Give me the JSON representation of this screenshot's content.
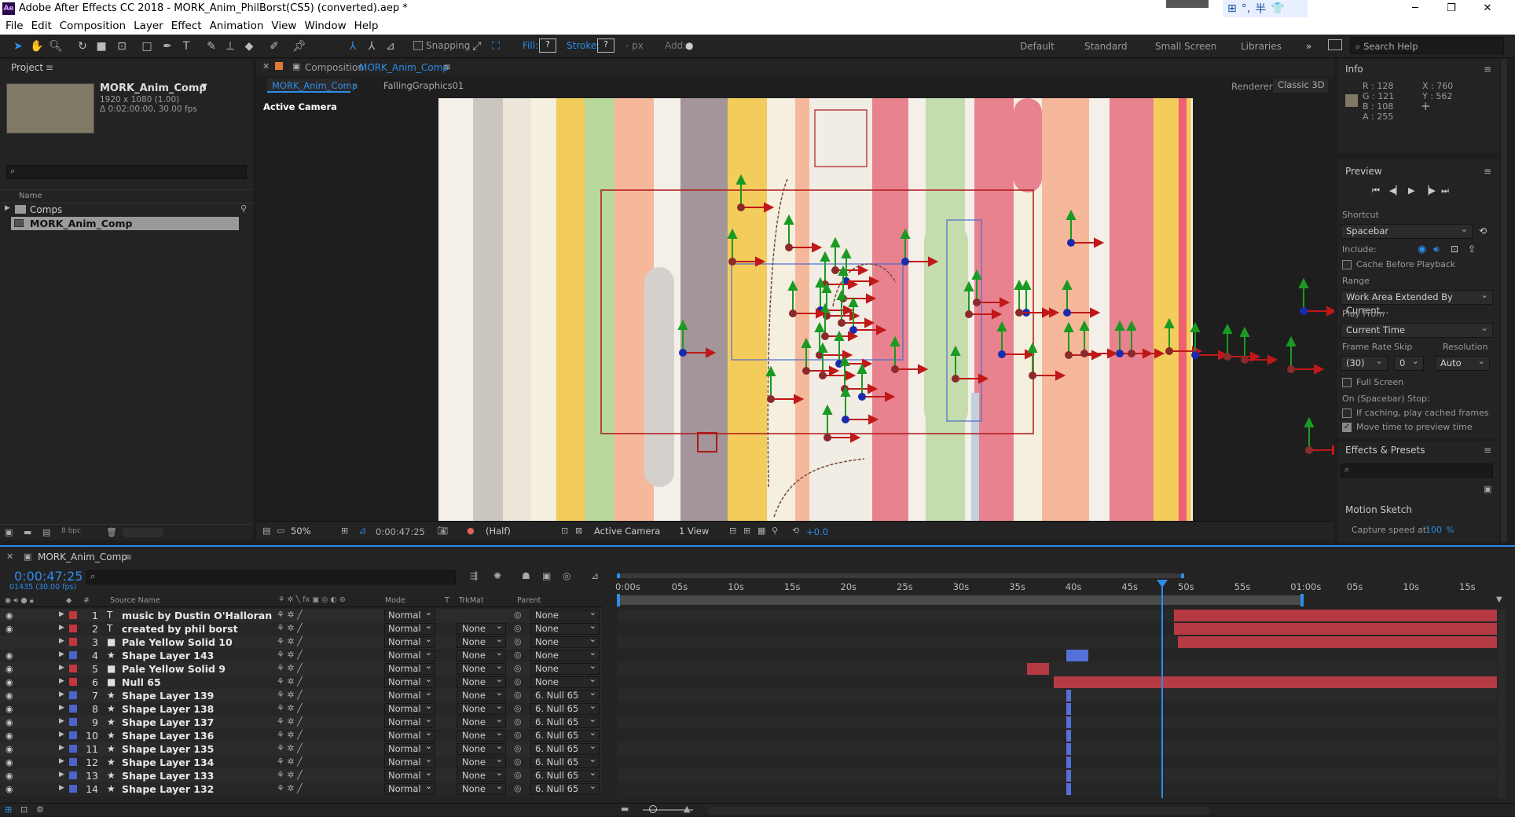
{
  "window": {
    "title": "Adobe After Effects CC 2018 - MORK_Anim_PhilBorst(CS5) (converted).aep *",
    "minimize": "─",
    "maximize": "❐",
    "close": "✕"
  },
  "menu": [
    "File",
    "Edit",
    "Composition",
    "Layer",
    "Effect",
    "Animation",
    "View",
    "Window",
    "Help"
  ],
  "toolbar": {
    "snapping": "Snapping",
    "fill": "Fill:",
    "stroke": "Stroke:",
    "stroke_value": "?",
    "fill_value": "?",
    "px": "- px",
    "add": "Add:",
    "workspaces": [
      "Default",
      "Standard",
      "Small Screen",
      "Libraries"
    ],
    "more": "»",
    "search_help": "Search Help"
  },
  "project": {
    "title": "Project",
    "comp_name": "MORK_Anim_Comp",
    "comp_size": "1920 x 1080 (1.00)",
    "comp_duration": "Δ 0:02:00:00, 30.00 fps",
    "search_placeholder": "",
    "col_name": "Name",
    "folder": "Comps",
    "item": "MORK_Anim_Comp",
    "bpc": "8 bpc"
  },
  "composition": {
    "header_prefix": "Composition",
    "header_name": "MORK_Anim_Comp",
    "tab_active": "MORK_Anim_Comp",
    "tab_other": "FallingGraphics01",
    "renderer_label": "Renderer:",
    "renderer": "Classic 3D",
    "view_label": "Active Camera",
    "zoom": "50%",
    "timecode": "0:00:47:25",
    "resolution": "(Half)",
    "camera": "Active Camera",
    "views": "1 View",
    "exposure": "+0.0"
  },
  "info": {
    "title": "Info",
    "r": "R : 128",
    "g": "G : 121",
    "b": "B : 108",
    "a": "A : 255",
    "x": "X : 760",
    "y": "Y : 562",
    "swatch": "#807965"
  },
  "preview": {
    "title": "Preview",
    "shortcut_label": "Shortcut",
    "shortcut": "Spacebar",
    "include_label": "Include:",
    "cache_before": "Cache Before Playback",
    "range_label": "Range",
    "range": "Work Area Extended By Current...",
    "play_from_label": "Play From",
    "play_from": "Current Time",
    "frame_rate_label": "Frame Rate",
    "skip_label": "Skip",
    "resolution_label": "Resolution",
    "frame_rate": "(30)",
    "skip": "0",
    "resolution": "Auto",
    "full_screen": "Full Screen",
    "on_stop_label": "On (Spacebar) Stop:",
    "if_caching": "If caching, play cached frames",
    "move_time": "Move time to preview time"
  },
  "effects": {
    "title": "Effects & Presets"
  },
  "motion_sketch": {
    "title": "Motion Sketch",
    "capture_label": "Capture speed at:",
    "capture_value": "100",
    "capture_unit": "%"
  },
  "timeline": {
    "tab": "MORK_Anim_Comp",
    "timecode": "0:00:47:25",
    "frames": "01435 (30.00 fps)",
    "col_hash": "#",
    "col_source": "Source Name",
    "col_mode": "Mode",
    "col_t": "T",
    "col_trkmat": "TrkMat",
    "col_parent": "Parent",
    "ruler": [
      "0:00s",
      "05s",
      "10s",
      "15s",
      "20s",
      "25s",
      "30s",
      "35s",
      "40s",
      "45s",
      "50s",
      "55s",
      "01:00s",
      "05s",
      "10s",
      "15s"
    ],
    "layers": [
      {
        "num": "1",
        "icon": "T",
        "name": "music by Dustin O'Halloran",
        "mode": "Normal",
        "trk": "",
        "parent": "None",
        "color": "#c4363b"
      },
      {
        "num": "2",
        "icon": "T",
        "name": "created by phil borst",
        "mode": "Normal",
        "trk": "None",
        "parent": "None",
        "color": "#c4363b"
      },
      {
        "num": "3",
        "icon": "■",
        "name": "Pale Yellow Solid 10",
        "mode": "Normal",
        "trk": "None",
        "parent": "None",
        "color": "#c4363b"
      },
      {
        "num": "4",
        "icon": "★",
        "name": "Shape Layer 143",
        "mode": "Normal",
        "trk": "None",
        "parent": "None",
        "color": "#4a64c8"
      },
      {
        "num": "5",
        "icon": "■",
        "name": "Pale Yellow Solid 9",
        "mode": "Normal",
        "trk": "None",
        "parent": "None",
        "color": "#c4363b"
      },
      {
        "num": "6",
        "icon": "■",
        "name": "Null 65",
        "mode": "Normal",
        "trk": "None",
        "parent": "None",
        "color": "#c4363b"
      },
      {
        "num": "7",
        "icon": "★",
        "name": "Shape Layer 139",
        "mode": "Normal",
        "trk": "None",
        "parent": "6. Null 65",
        "color": "#4a64c8"
      },
      {
        "num": "8",
        "icon": "★",
        "name": "Shape Layer 138",
        "mode": "Normal",
        "trk": "None",
        "parent": "6. Null 65",
        "color": "#4a64c8"
      },
      {
        "num": "9",
        "icon": "★",
        "name": "Shape Layer 137",
        "mode": "Normal",
        "trk": "None",
        "parent": "6. Null 65",
        "color": "#4a64c8"
      },
      {
        "num": "10",
        "icon": "★",
        "name": "Shape Layer 136",
        "mode": "Normal",
        "trk": "None",
        "parent": "6. Null 65",
        "color": "#4a64c8"
      },
      {
        "num": "11",
        "icon": "★",
        "name": "Shape Layer 135",
        "mode": "Normal",
        "trk": "None",
        "parent": "6. Null 65",
        "color": "#4a64c8"
      },
      {
        "num": "12",
        "icon": "★",
        "name": "Shape Layer 134",
        "mode": "Normal",
        "trk": "None",
        "parent": "6. Null 65",
        "color": "#4a64c8"
      },
      {
        "num": "13",
        "icon": "★",
        "name": "Shape Layer 133",
        "mode": "Normal",
        "trk": "None",
        "parent": "6. Null 65",
        "color": "#4a64c8"
      },
      {
        "num": "14",
        "icon": "★",
        "name": "Shape Layer 132",
        "mode": "Normal",
        "trk": "None",
        "parent": "6. Null 65",
        "color": "#4a64c8"
      }
    ]
  }
}
